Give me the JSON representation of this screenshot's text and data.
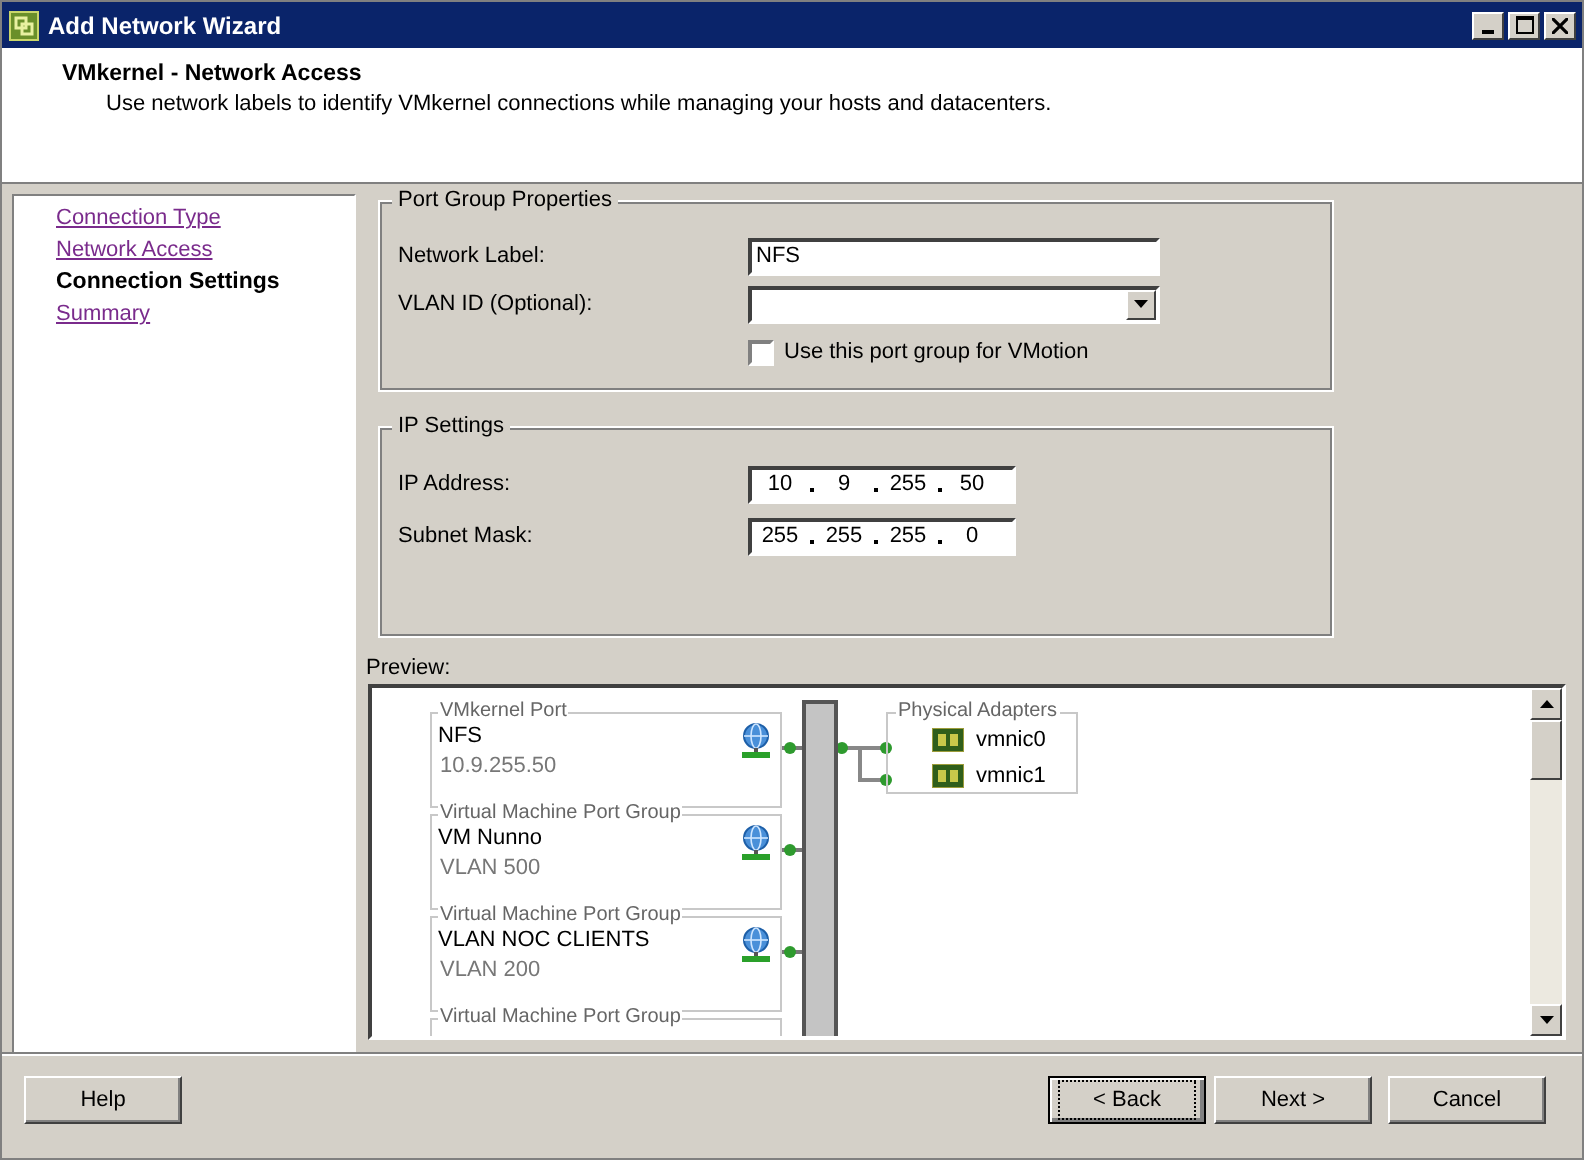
{
  "window": {
    "title": "Add Network Wizard"
  },
  "header": {
    "title": "VMkernel - Network Access",
    "description": "Use network labels to identify VMkernel connections while managing your hosts and datacenters."
  },
  "steps": [
    {
      "label": "Connection Type",
      "selected": false
    },
    {
      "label": "Network Access",
      "selected": false
    },
    {
      "label": "Connection Settings",
      "selected": true
    },
    {
      "label": "Summary",
      "selected": false
    }
  ],
  "port_group_properties": {
    "legend": "Port Group Properties",
    "network_label": {
      "label": "Network Label:",
      "value": "NFS"
    },
    "vlan_id": {
      "label": "VLAN ID (Optional):"
    },
    "vmotion": {
      "label": "Use this port group for VMotion",
      "checked": false
    }
  },
  "ip_settings": {
    "legend": "IP Settings",
    "fields": [
      {
        "label": "IP Address:",
        "octets": [
          "10",
          "9",
          "255",
          "50"
        ]
      },
      {
        "label": "Subnet Mask:",
        "octets": [
          "255",
          "255",
          "255",
          "0"
        ]
      }
    ]
  },
  "preview": {
    "label": "Preview:",
    "port_groups": [
      {
        "type": "VMkernel Port",
        "name": "NFS",
        "detail": "10.9.255.50"
      },
      {
        "type": "Virtual Machine Port Group",
        "name": "VM Nunno",
        "detail": "VLAN 500"
      },
      {
        "type": "Virtual Machine Port Group",
        "name": "VLAN NOC CLIENTS",
        "detail": "VLAN 200"
      },
      {
        "type": "Virtual Machine Port Group"
      }
    ],
    "adapters_legend": "Physical Adapters",
    "adapters": [
      "vmnic0",
      "vmnic1"
    ]
  },
  "buttons": [
    {
      "label": "Help",
      "focused": false
    },
    {
      "label": "< Back",
      "focused": true
    },
    {
      "label": "Next >",
      "focused": false
    },
    {
      "label": "Cancel",
      "focused": false
    }
  ]
}
